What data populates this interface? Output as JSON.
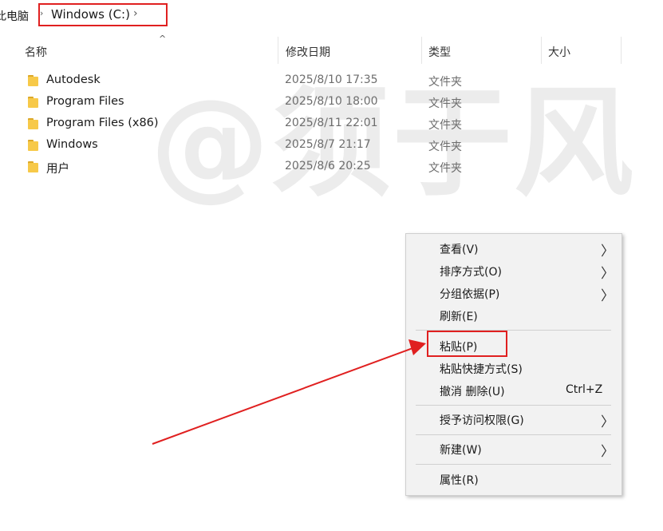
{
  "breadcrumb": {
    "root_label": "此电脑",
    "separator": "›",
    "current": "Windows (C:)",
    "chevron": "›"
  },
  "columns": {
    "name": "名称",
    "date": "修改日期",
    "type": "类型",
    "size": "大小"
  },
  "files": [
    {
      "name": "Autodesk",
      "date": "2025/8/10 17:35",
      "type": "文件夹"
    },
    {
      "name": "Program Files",
      "date": "2025/8/10 18:00",
      "type": "文件夹"
    },
    {
      "name": "Program Files (x86)",
      "date": "2025/8/11 22:01",
      "type": "文件夹"
    },
    {
      "name": "Windows",
      "date": "2025/8/7 21:17",
      "type": "文件夹"
    },
    {
      "name": "用户",
      "date": "2025/8/6 20:25",
      "type": "文件夹"
    }
  ],
  "watermark": "@须于风",
  "context_menu": {
    "items": [
      {
        "label": "查看(V)",
        "has_submenu": true
      },
      {
        "label": "排序方式(O)",
        "has_submenu": true
      },
      {
        "label": "分组依据(P)",
        "has_submenu": true
      },
      {
        "label": "刷新(E)"
      },
      {
        "label": "粘贴(P)"
      },
      {
        "label": "粘贴快捷方式(S)"
      },
      {
        "label": "撤消 删除(U)",
        "shortcut": "Ctrl+Z"
      },
      {
        "label": "授予访问权限(G)",
        "has_submenu": true
      },
      {
        "label": "新建(W)",
        "has_submenu": true
      },
      {
        "label": "属性(R)"
      }
    ],
    "submenu_arrow": "〉"
  },
  "colors": {
    "highlight": "#e02020",
    "folder": "#f7c949",
    "menu_bg": "#f2f2f2"
  },
  "icons": {
    "folder": "folder-icon",
    "submenu": "chevron-right-icon",
    "sort": "sort-ascending-icon"
  }
}
